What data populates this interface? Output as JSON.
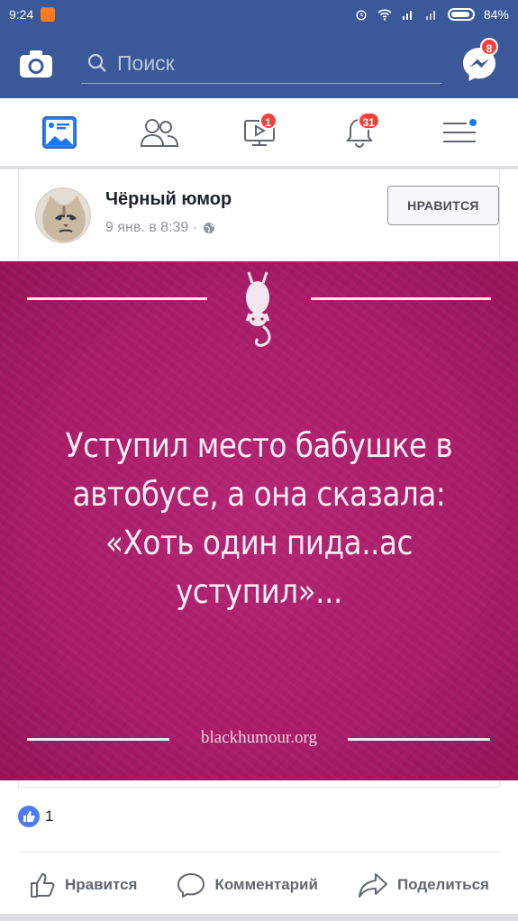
{
  "status_bar": {
    "time": "9:24",
    "battery": "84%"
  },
  "topbar": {
    "search_placeholder": "Поиск",
    "messenger_badge": "8"
  },
  "nav": {
    "items": [
      {
        "name": "news-feed",
        "badge": ""
      },
      {
        "name": "friends",
        "badge": ""
      },
      {
        "name": "watch",
        "badge": "1"
      },
      {
        "name": "notifications",
        "badge": "31"
      },
      {
        "name": "menu",
        "badge": ""
      }
    ]
  },
  "post": {
    "page_name": "Чёрный юмор",
    "meta": "9 янв. в 8:39 ·",
    "like_page_button": "НРАВИТСЯ",
    "image": {
      "quote": "Уступил место бабушке в автобусе, а она сказала: «Хоть один пида..ас уступил»...",
      "watermark": "blackhumour.org"
    },
    "likes_count": "1",
    "actions": {
      "like": "Нравится",
      "comment": "Комментарий",
      "share": "Поделиться"
    }
  },
  "colors": {
    "brand": "#3b5998",
    "image_bg": "#a91d68",
    "badge": "#fa3e3e"
  }
}
